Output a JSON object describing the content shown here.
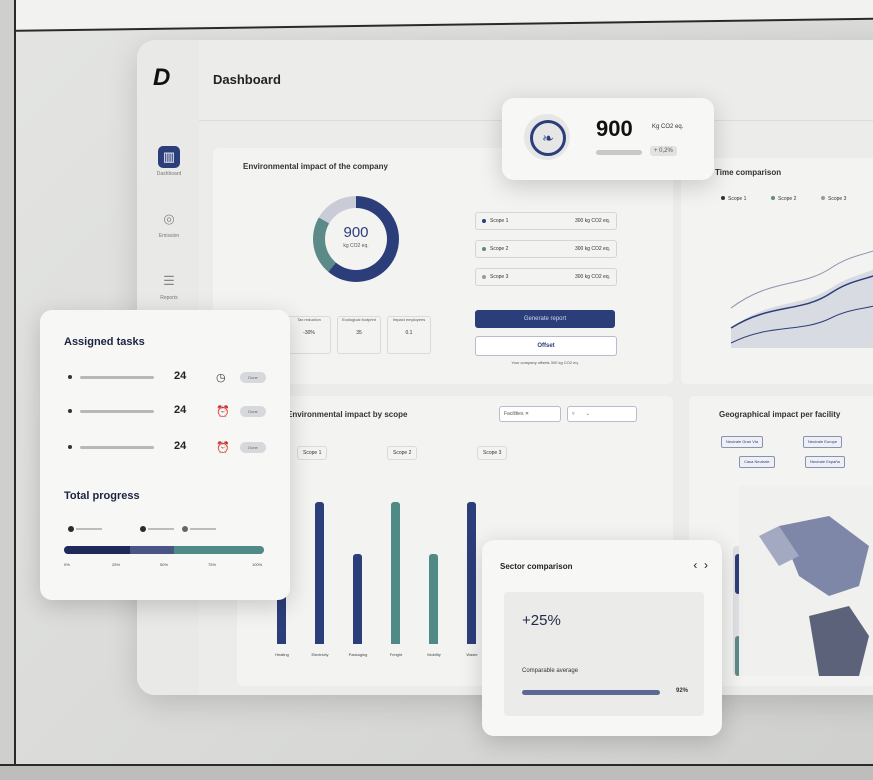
{
  "app": {
    "title": "Dashboard",
    "logo": "D"
  },
  "sidebar": [
    {
      "label": "Dashboard",
      "icon": "chart-icon",
      "active": true
    },
    {
      "label": "Emission",
      "icon": "target-icon"
    },
    {
      "label": "Reports",
      "icon": "report-icon"
    }
  ],
  "environment": {
    "title": "Environmental impact of the company",
    "total": "900",
    "unit": "kg CO2 eq.",
    "scopes": [
      {
        "name": "Scope 1",
        "value": "300 kg CO2 eq."
      },
      {
        "name": "Scope 2",
        "value": "300 kg CO2 eq."
      },
      {
        "name": "Scope 3",
        "value": "300 kg CO2 eq."
      }
    ],
    "generate_button": "Generate report",
    "offset_button": "Offset",
    "note": "Your company offsets 300 kg CO2 eq.",
    "stats": [
      {
        "label": "Tax reduction",
        "value": "-30%"
      },
      {
        "label": "Ecological footprint",
        "value": "35"
      },
      {
        "label": "Impact employees",
        "value": "0.1"
      }
    ]
  },
  "co2_card": {
    "value": "900",
    "unit": "Kg CO2 eq.",
    "delta": "+ 0,2%"
  },
  "time_comparison": {
    "title": "Time comparison",
    "legend": [
      "Scope 1",
      "Scope 2",
      "Scope 3"
    ]
  },
  "scope_chart": {
    "title": "Environmental impact by scope",
    "filter": "Facilities",
    "scopes": [
      "Scope 1",
      "Scope 2",
      "Scope 3"
    ],
    "categories": [
      "Heating",
      "Electricity",
      "Packaging",
      "Freight",
      "Mobility",
      "Waste"
    ],
    "values": [
      90,
      95,
      60,
      95,
      60,
      95
    ]
  },
  "geo": {
    "title": "Geographical impact per facility",
    "chips": [
      "Neutrale Gran Via",
      "Neutrale Europe",
      "Casa Neutrale",
      "Neutrale España"
    ]
  },
  "tasks": {
    "title": "Assigned tasks",
    "items": [
      {
        "count": "24",
        "icon": "clock-icon",
        "status": "Done"
      },
      {
        "count": "24",
        "icon": "alarm-icon",
        "status": "Done"
      },
      {
        "count": "24",
        "icon": "alarm-icon",
        "status": "Done"
      }
    ],
    "progress_title": "Total progress",
    "ticks": [
      "0%",
      "25%",
      "50%",
      "75%",
      "100%"
    ],
    "progress": [
      0.33,
      0.55,
      1.0
    ]
  },
  "sector": {
    "title": "Sector comparison",
    "value": "+25%",
    "label": "Comparable average",
    "percent": "92%",
    "fill": 0.92
  },
  "colors": {
    "primary": "#2c3e7a",
    "teal": "#5b8a88",
    "light": "#c9ccd6"
  }
}
